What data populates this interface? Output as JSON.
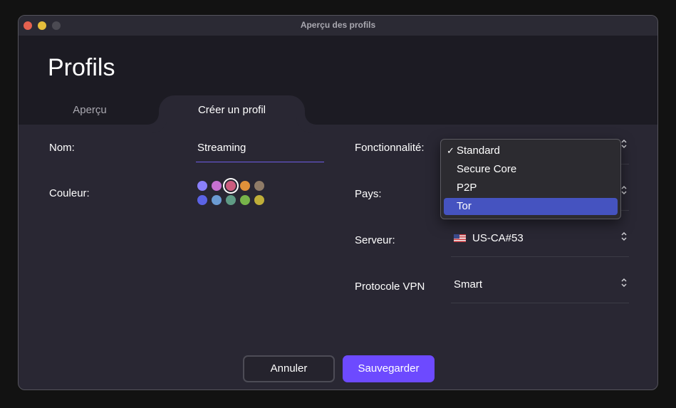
{
  "window": {
    "title": "Aperçu des profils"
  },
  "header": {
    "title": "Profils",
    "tabs": [
      {
        "label": "Aperçu",
        "active": false
      },
      {
        "label": "Créer un profil",
        "active": true
      }
    ]
  },
  "form": {
    "name": {
      "label": "Nom:",
      "value": "Streaming"
    },
    "color": {
      "label": "Couleur:",
      "selected_index": 2,
      "swatches": [
        "#8a80fb",
        "#c770d1",
        "#cb5c7e",
        "#e0913a",
        "#8f7b67",
        "#5b63e6",
        "#6b9bd3",
        "#5f9b85",
        "#77b44a",
        "#bfae39"
      ]
    },
    "feature": {
      "label": "Fonctionnalité:",
      "value": "Standard"
    },
    "country": {
      "label": "Pays:",
      "value": ""
    },
    "server": {
      "label": "Serveur:",
      "value": "US-CA#53",
      "flag": "us-flag"
    },
    "protocol": {
      "label": "Protocole VPN",
      "value": "Smart"
    }
  },
  "dropdown": {
    "options": [
      {
        "label": "Standard",
        "checked": true,
        "highlighted": false,
        "check_glyph": "✓"
      },
      {
        "label": "Secure Core",
        "checked": false,
        "highlighted": false
      },
      {
        "label": "P2P",
        "checked": false,
        "highlighted": false
      },
      {
        "label": "Tor",
        "checked": false,
        "highlighted": true
      }
    ]
  },
  "buttons": {
    "cancel": "Annuler",
    "save": "Sauvegarder"
  },
  "colors": {
    "accent": "#6d4aff",
    "highlight": "#4553c0",
    "underline": "#6d5ce6"
  }
}
